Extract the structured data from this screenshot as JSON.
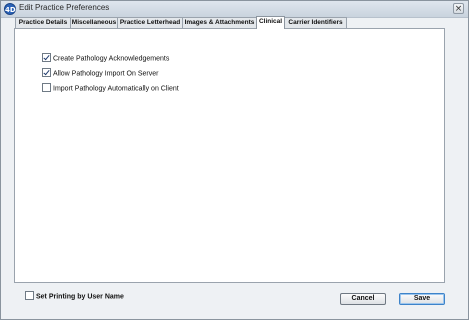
{
  "window": {
    "title": "Edit Practice Preferences",
    "icon_label": "4D",
    "close_glyph": "×"
  },
  "tabs": [
    {
      "label": "Practice Details",
      "active": false
    },
    {
      "label": "Miscellaneous",
      "active": false
    },
    {
      "label": "Practice Letterhead",
      "active": false
    },
    {
      "label": "Images & Attachments",
      "active": false
    },
    {
      "label": "Clinical",
      "active": true
    },
    {
      "label": "Carrier Identifiers",
      "active": false
    }
  ],
  "clinical": {
    "options": [
      {
        "label": "Create Pathology Acknowledgements",
        "checked": true
      },
      {
        "label": "Allow Pathology Import On Server",
        "checked": true
      },
      {
        "label": "Import Pathology Automatically on Client",
        "checked": false
      }
    ]
  },
  "footer": {
    "set_printing_label": "Set Printing by User Name",
    "set_printing_checked": false,
    "cancel_label": "Cancel",
    "save_label": "Save"
  }
}
